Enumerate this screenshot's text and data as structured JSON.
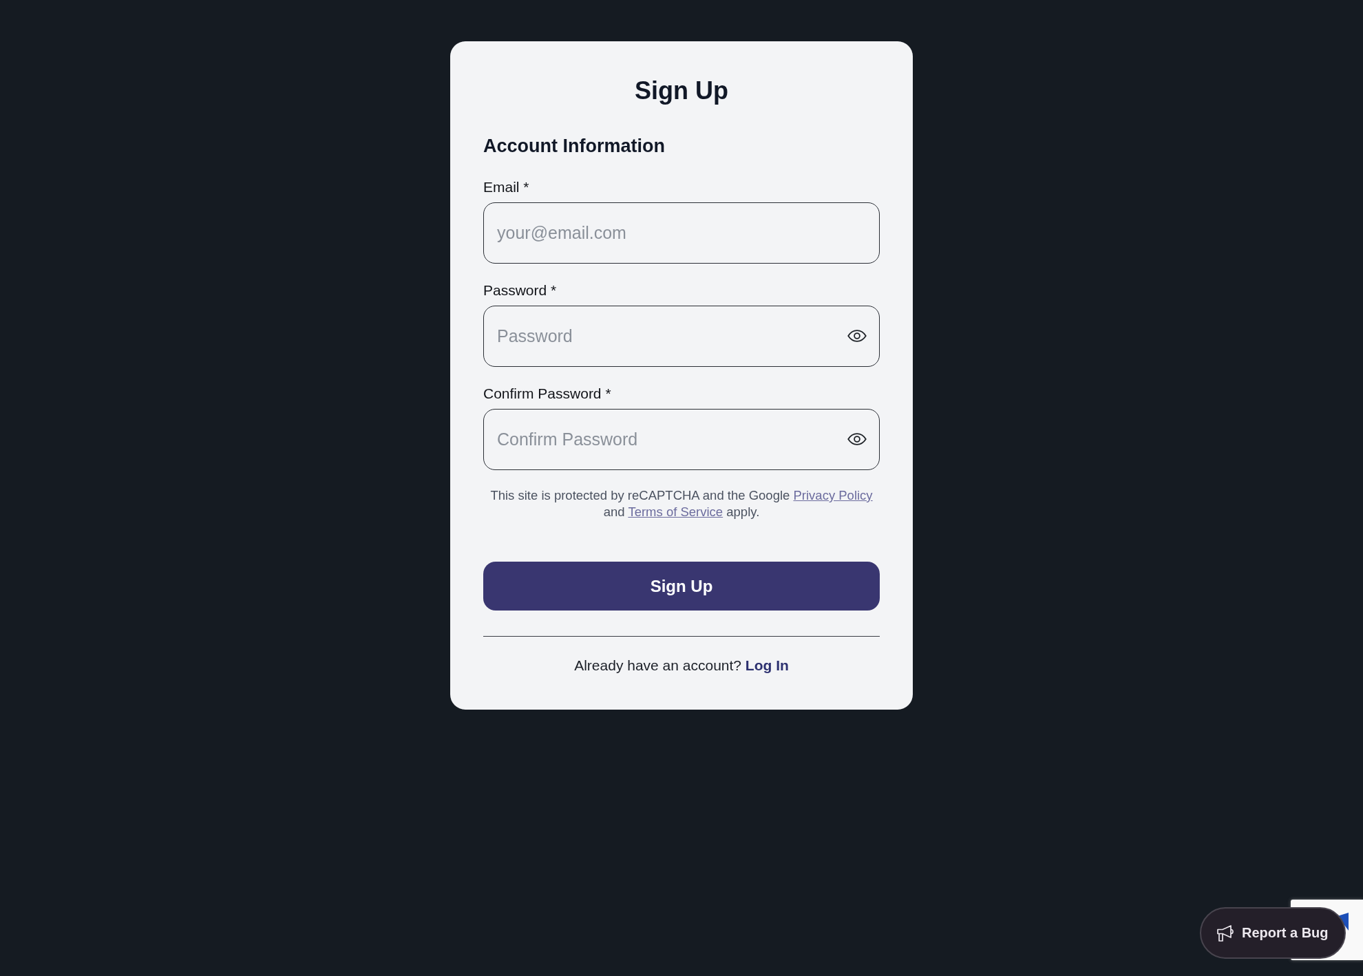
{
  "signup_form": {
    "title": "Sign Up",
    "section_title": "Account Information",
    "fields": [
      {
        "label": "Email *",
        "placeholder": "your@email.com",
        "reveal_toggle": false
      },
      {
        "label": "Password *",
        "placeholder": "Password",
        "reveal_toggle": true
      },
      {
        "label": "Confirm Password *",
        "placeholder": "Confirm Password",
        "reveal_toggle": true
      }
    ],
    "recaptcha_notice": [
      {
        "kind": "text",
        "text": "This site is protected by reCAPTCHA and the Google"
      },
      {
        "kind": "link",
        "text": "Privacy Policy"
      },
      {
        "kind": "text",
        "text": "and"
      },
      {
        "kind": "link",
        "text": "Terms of Service"
      },
      {
        "kind": "text",
        "text": "apply."
      }
    ],
    "submit_button": "Sign Up",
    "login_prompt": {
      "text": "Already have an account?",
      "link": "Log In"
    }
  },
  "report_bug_button": {
    "label": "Report a Bug"
  }
}
